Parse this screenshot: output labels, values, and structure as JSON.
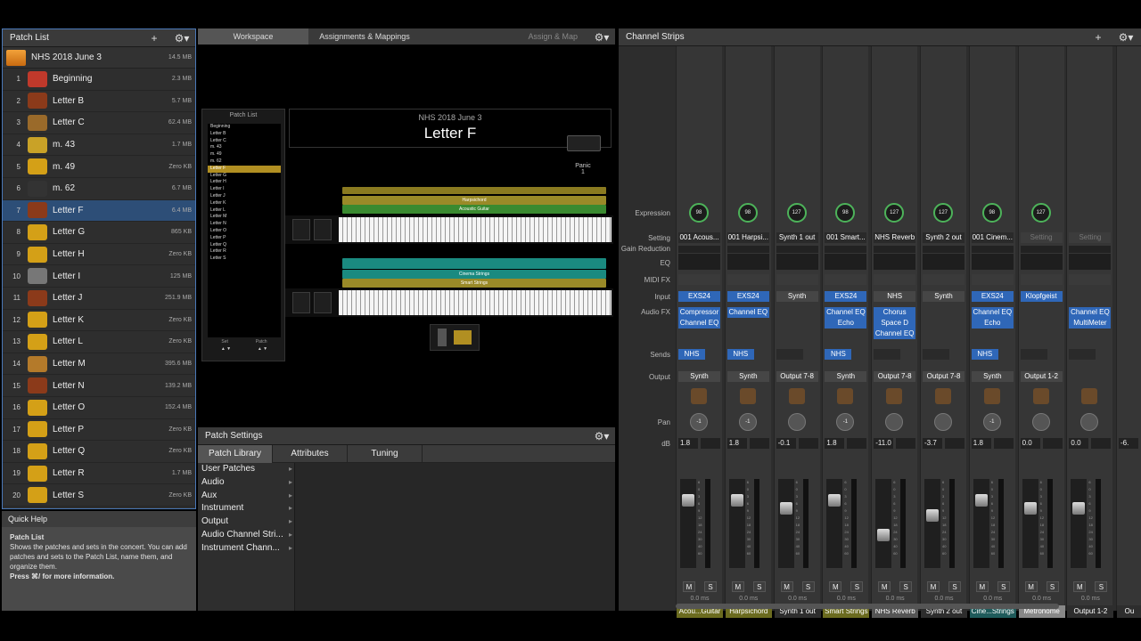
{
  "patch_list": {
    "title": "Patch List",
    "add_icon": "+",
    "gear_icon": "⚙",
    "concert": {
      "name": "NHS 2018 June 3",
      "size": "14.5 MB"
    },
    "patches": [
      {
        "num": "1",
        "name": "Beginning",
        "size": "2.3 MB",
        "icon": "guitar-amp"
      },
      {
        "num": "2",
        "name": "Letter B",
        "size": "5.7 MB",
        "icon": "strings"
      },
      {
        "num": "3",
        "name": "Letter C",
        "size": "62.4 MB",
        "icon": "cello"
      },
      {
        "num": "4",
        "name": "m. 43",
        "size": "1.7 MB",
        "icon": "metronome"
      },
      {
        "num": "5",
        "name": "m. 49",
        "size": "Zero KB",
        "icon": "horn"
      },
      {
        "num": "6",
        "name": "m. 62",
        "size": "6.7 MB",
        "icon": "piano"
      },
      {
        "num": "7",
        "name": "Letter F",
        "size": "6.4 MB",
        "icon": "strings"
      },
      {
        "num": "8",
        "name": "Letter G",
        "size": "865 KB",
        "icon": "horn"
      },
      {
        "num": "9",
        "name": "Letter H",
        "size": "Zero KB",
        "icon": "horn"
      },
      {
        "num": "10",
        "name": "Letter I",
        "size": "125 MB",
        "icon": "synth"
      },
      {
        "num": "11",
        "name": "Letter J",
        "size": "251.9 MB",
        "icon": "strings"
      },
      {
        "num": "12",
        "name": "Letter K",
        "size": "Zero KB",
        "icon": "horn"
      },
      {
        "num": "13",
        "name": "Letter L",
        "size": "Zero KB",
        "icon": "horn"
      },
      {
        "num": "14",
        "name": "Letter M",
        "size": "395.6 MB",
        "icon": "guitar"
      },
      {
        "num": "15",
        "name": "Letter N",
        "size": "139.2 MB",
        "icon": "strings"
      },
      {
        "num": "16",
        "name": "Letter O",
        "size": "152.4 MB",
        "icon": "horn"
      },
      {
        "num": "17",
        "name": "Letter P",
        "size": "Zero KB",
        "icon": "horn"
      },
      {
        "num": "18",
        "name": "Letter Q",
        "size": "Zero KB",
        "icon": "horn"
      },
      {
        "num": "19",
        "name": "Letter R",
        "size": "1.7 MB",
        "icon": "horn"
      },
      {
        "num": "20",
        "name": "Letter S",
        "size": "Zero KB",
        "icon": "horn"
      }
    ]
  },
  "quick_help": {
    "title": "Quick Help",
    "heading": "Patch List",
    "body": "Shows the patches and sets in the concert. You can add patches and sets to the Patch List, name them, and organize them.",
    "more": "Press ⌘/ for more information."
  },
  "workspace": {
    "tabs": [
      "Workspace",
      "Assignments & Mappings"
    ],
    "assign_map": "Assign & Map",
    "inner_patch_list": {
      "title": "Patch List",
      "items": [
        "Beginning",
        "Letter B",
        "Letter C",
        "m. 43",
        "m. 49",
        "m. 62",
        "Letter F",
        "Letter G",
        "Letter H",
        "Letter I",
        "Letter J",
        "Letter K",
        "Letter L",
        "Letter M",
        "Letter N",
        "Letter O",
        "Letter P",
        "Letter Q",
        "Letter R",
        "Letter S"
      ],
      "set_label": "Set",
      "patch_label": "Patch"
    },
    "concert_name": "NHS 2018 June 3",
    "patch_name": "Letter F",
    "panic_label": "Panic",
    "panic_value": "1",
    "keyboard1_layers": [
      "Harpsichord",
      "Acoustic Guitar"
    ],
    "keyboard2_layers": [
      "Cinema Strings",
      "Smart Strings"
    ]
  },
  "patch_settings": {
    "title": "Patch Settings",
    "tabs": [
      "Patch Library",
      "Attributes",
      "Tuning"
    ],
    "library": [
      "User Patches",
      "Audio",
      "Aux",
      "Instrument",
      "Output",
      "Audio Channel Stri...",
      "Instrument Chann..."
    ]
  },
  "channel_strips": {
    "title": "Channel Strips",
    "row_labels": {
      "expression": "Expression",
      "setting": "Setting",
      "gain": "Gain Reduction",
      "eq": "EQ",
      "midifx": "MIDI FX",
      "input": "Input",
      "audiofx": "Audio FX",
      "sends": "Sends",
      "output": "Output",
      "pan": "Pan",
      "db": "dB"
    },
    "strips": [
      {
        "expr": "98",
        "setting": "001 Acous...",
        "input": "EXS24",
        "fx": [
          "Compressor",
          "Channel EQ"
        ],
        "send": "NHS",
        "output": "Synth",
        "pan": "-1",
        "db": "1.8",
        "name": "Acou...Guitar",
        "color": "#6b6b1f",
        "level": 0.8
      },
      {
        "expr": "98",
        "setting": "001 Harpsi...",
        "input": "EXS24",
        "fx": [
          "Channel EQ"
        ],
        "send": "NHS",
        "output": "Synth",
        "pan": "-1",
        "db": "1.8",
        "name": "Harpsichord",
        "color": "#6b6b1f",
        "level": 0.8
      },
      {
        "expr": "127",
        "setting": "Synth 1 out",
        "input": "Synth",
        "fx": [],
        "send": "",
        "output": "Output 7-8",
        "pan": "",
        "db": "-0.1",
        "name": "Synth 1 out",
        "color": "#2d2d2d",
        "level": 0.7
      },
      {
        "expr": "98",
        "setting": "001 Smart...",
        "input": "EXS24",
        "fx": [
          "Channel EQ",
          "Echo"
        ],
        "send": "NHS",
        "output": "Synth",
        "pan": "-1",
        "db": "1.8",
        "name": "Smart Strings",
        "color": "#6b6b1f",
        "level": 0.8
      },
      {
        "expr": "127",
        "setting": "NHS Reverb",
        "input": "NHS",
        "fx": [
          "Chorus",
          "Space D",
          "Channel EQ"
        ],
        "send": "",
        "output": "Output 7-8",
        "pan": "",
        "db": "-11.0",
        "name": "NHS Reverb",
        "color": "#555",
        "level": 0.35
      },
      {
        "expr": "127",
        "setting": "Synth 2 out",
        "input": "Synth",
        "fx": [],
        "send": "",
        "output": "Output 7-8",
        "pan": "",
        "db": "-3.7",
        "name": "Synth 2 out",
        "color": "#2d2d2d",
        "level": 0.6
      },
      {
        "expr": "98",
        "setting": "001 Cinem...",
        "input": "EXS24",
        "fx": [
          "Channel EQ",
          "Echo"
        ],
        "send": "NHS",
        "output": "Synth",
        "pan": "-1",
        "db": "1.8",
        "name": "Cine...Strings",
        "color": "#1f5b5b",
        "level": 0.8
      },
      {
        "expr": "127",
        "setting": "Setting",
        "input": "Klopfgeist",
        "fx": [],
        "send": "",
        "output": "Output 1-2",
        "pan": "",
        "db": "0.0",
        "name": "Metronome",
        "color": "#888",
        "level": 0.7
      },
      {
        "expr": "",
        "setting": "Setting",
        "input": "",
        "fx": [
          "Channel EQ",
          "MultiMeter"
        ],
        "send": "",
        "output": "",
        "pan": "",
        "db": "0.0",
        "name": "Output 1-2",
        "color": "#2d2d2d",
        "level": 0.7
      }
    ],
    "cutoff": {
      "db": "-6.",
      "name": "Ou"
    }
  },
  "colors": {
    "selected": "#2d4e77",
    "accent": "#2f67b8",
    "knob": "#4db35a",
    "panic_yellow": "#b18f22"
  }
}
